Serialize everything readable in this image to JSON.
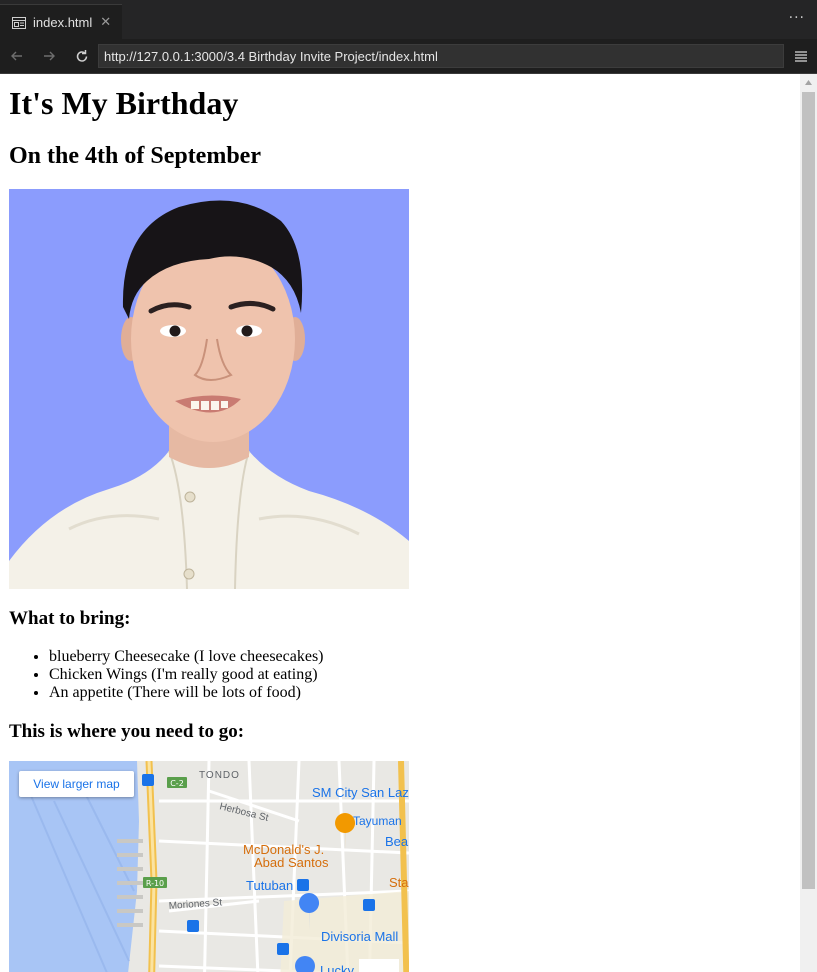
{
  "tab": {
    "title": "index.html",
    "close_glyph": "✕",
    "icon": "preview-icon"
  },
  "toolbar": {
    "more_glyph": "···",
    "url": "http://127.0.0.1:3000/3.4 Birthday Invite Project/index.html"
  },
  "page": {
    "heading": "It's My Birthday",
    "date": "On the 4th of September",
    "bring_heading": "What to bring:",
    "bring_items": [
      "blueberry Cheesecake (I love cheesecakes)",
      "Chicken Wings (I'm really good at eating)",
      "An appetite (There will be lots of food)"
    ],
    "where_heading": "This is where you need to go:",
    "map": {
      "button_label": "View larger map",
      "labels": {
        "tondo": "TONDO",
        "herbosa": "Herbosa St",
        "sm": "SM City San Laz",
        "tayuman": "Tayuman",
        "bea": "Bea",
        "mcd1": "McDonald's J.",
        "mcd2": "Abad Santos",
        "tutuban": "Tutuban",
        "sta": "Sta",
        "moriones": "Moriones St",
        "divisoria": "Divisoria Mall",
        "lucky": "Lucky",
        "c2": "C-2",
        "r10": "R-10"
      }
    }
  },
  "colors": {
    "photo_bg": "#8b9cfd",
    "map_water": "#a8c5f5",
    "map_land": "#e9e8e4",
    "map_link": "#1a73e8"
  }
}
